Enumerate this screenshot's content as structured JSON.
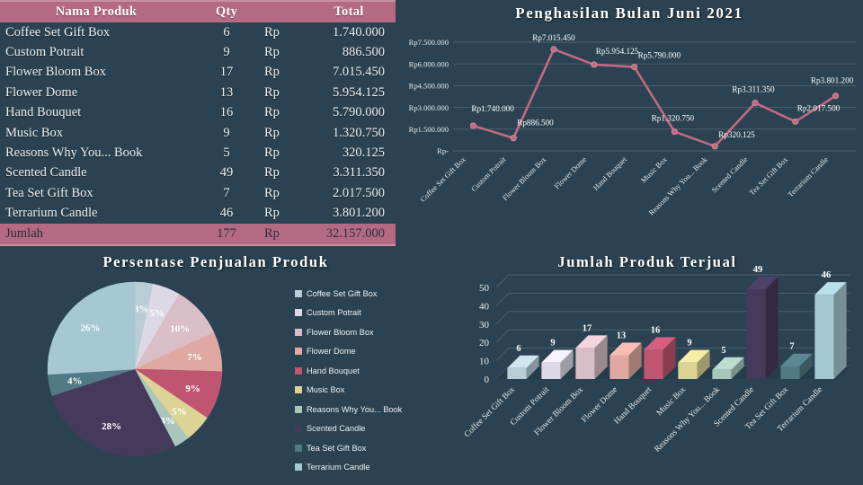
{
  "palette": {
    "background": "#2a4251",
    "header_mauve": "#b56a83",
    "header_mauve_light": "#c78fa2",
    "line_color": "#c06a80",
    "text_light": "#f0f0f0",
    "gridline": "#50646f"
  },
  "table": {
    "columns": [
      "Nama Produk",
      "Qty",
      "Total"
    ],
    "currency_symbol": "Rp",
    "rows": [
      {
        "name": "Coffee Set Gift Box",
        "qty": 6,
        "total": "1.740.000"
      },
      {
        "name": "Custom Potrait",
        "qty": 9,
        "total": "886.500"
      },
      {
        "name": "Flower Bloom Box",
        "qty": 17,
        "total": "7.015.450"
      },
      {
        "name": "Flower Dome",
        "qty": 13,
        "total": "5.954.125"
      },
      {
        "name": "Hand Bouquet",
        "qty": 16,
        "total": "5.790.000"
      },
      {
        "name": "Music Box",
        "qty": 9,
        "total": "1.320.750"
      },
      {
        "name": "Reasons Why You... Book",
        "qty": 5,
        "total": "320.125"
      },
      {
        "name": "Scented Candle",
        "qty": 49,
        "total": "3.311.350"
      },
      {
        "name": "Tea Set Gift Box",
        "qty": 7,
        "total": "2.017.500"
      },
      {
        "name": "Terrarium Candle",
        "qty": 46,
        "total": "3.801.200"
      }
    ],
    "total_row": {
      "label": "Jumlah",
      "qty": 177,
      "currency_symbol": "Rp",
      "total": "32.157.000"
    }
  },
  "chart_data": [
    {
      "type": "line",
      "title": "Penghasilan  Bulan  Juni  2021",
      "xlabel": "",
      "ylabel": "",
      "ylim": [
        0,
        7500000
      ],
      "grid": true,
      "legend": "none",
      "ytick_labels": [
        "Rp-",
        "Rp1.500.000",
        "Rp3.000.000",
        "Rp4.500.000",
        "Rp6.000.000",
        "Rp7.500.000"
      ],
      "ytick_values": [
        0,
        1500000,
        3000000,
        4500000,
        6000000,
        7500000
      ],
      "categories": [
        "Coffee Set Gift Box",
        "Custom Potrait",
        "Flower Bloom Box",
        "Flower Dome",
        "Hand Bouquet",
        "Music Box",
        "Reasons Why You... Book",
        "Scented Candle",
        "Tea Set Gift Box",
        "Terrarium Candle"
      ],
      "values": [
        1740000,
        886500,
        7015450,
        5954125,
        5790000,
        1320750,
        320125,
        3311350,
        2017500,
        3801200
      ],
      "point_labels": [
        "Rp1.740.000",
        "Rp886.500",
        "Rp7.015.450",
        "Rp5.954.125",
        "Rp5.790.000",
        "Rp1.320.750",
        "Rp320.125",
        "Rp3.311.350",
        "Rp2.017.500",
        "Rp3.801.200"
      ],
      "series_color": "#c06a80"
    },
    {
      "type": "pie",
      "title": "Persentase  Penjualan  Produk",
      "legend": "right",
      "labels": [
        "Coffee Set Gift Box",
        "Custom Potrait",
        "Flower Bloom Box",
        "Flower Dome",
        "Hand Bouquet",
        "Music Box",
        "Reasons Why You... Book",
        "Scented Candle",
        "Tea Set Gift Box",
        "Terrarium Candle"
      ],
      "values": [
        6,
        9,
        17,
        13,
        16,
        9,
        5,
        49,
        7,
        46
      ],
      "percent_labels": [
        "3%",
        "5%",
        "10%",
        "7%",
        "9%",
        "5%",
        "3%",
        "28%",
        "4%",
        "26%"
      ],
      "colors": [
        "#b8cdd6",
        "#dcd8e6",
        "#d9bec7",
        "#dfa9a1",
        "#bf5571",
        "#ddd394",
        "#a8c6bb",
        "#463a5c",
        "#527986",
        "#a5c8d2"
      ]
    },
    {
      "type": "bar",
      "title": "Jumlah  Produk  Terjual",
      "xlabel": "",
      "ylabel": "",
      "ylim": [
        0,
        50
      ],
      "grid": true,
      "legend": "none",
      "ytick_labels": [
        "0",
        "10",
        "20",
        "30",
        "40",
        "50"
      ],
      "ytick_values": [
        0,
        10,
        20,
        30,
        40,
        50
      ],
      "categories": [
        "Coffee Set Gift Box",
        "Custom Potrait",
        "Flower Bloom Box",
        "Flower Dome",
        "Hand Bouquet",
        "Music Box",
        "Reasons Why You... Book",
        "Scented Candle",
        "Tea Set Gift Box",
        "Terrarium Candle"
      ],
      "values": [
        6,
        9,
        17,
        13,
        16,
        9,
        5,
        49,
        7,
        46
      ],
      "colors": [
        "#b8cdd6",
        "#dcd8e6",
        "#d9bec7",
        "#dfa9a1",
        "#bf5571",
        "#ddd394",
        "#a8c6bb",
        "#463a5c",
        "#527986",
        "#a5c8d2"
      ]
    }
  ]
}
